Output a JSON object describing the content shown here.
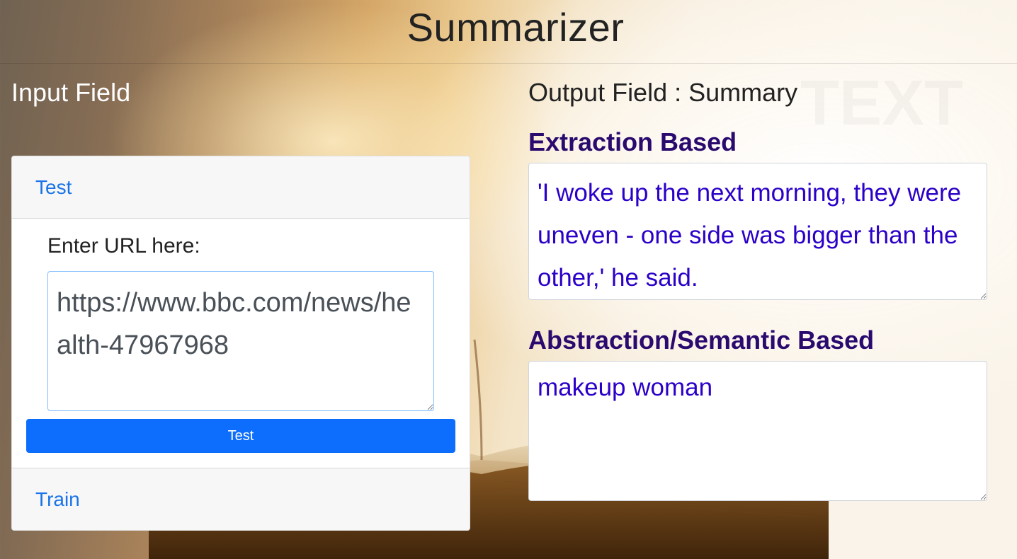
{
  "header": {
    "title": "Summarizer"
  },
  "input_panel": {
    "heading": "Input Field",
    "tabs": {
      "test_label": "Test",
      "train_label": "Train"
    },
    "url_label": "Enter URL here:",
    "url_value": "https://www.bbc.com/news/health-47967968",
    "submit_label": "Test"
  },
  "output_panel": {
    "heading": "Output Field : Summary",
    "extraction": {
      "title": "Extraction Based",
      "text": "'I woke up the next morning, they were uneven - one side was bigger than the other,' he said."
    },
    "abstraction": {
      "title": "Abstraction/Semantic Based",
      "text": "makeup woman"
    }
  },
  "colors": {
    "link": "#1a73e8",
    "button": "#0d6efd",
    "section_title": "#2a0a6e",
    "output_text": "#2b00c8"
  },
  "icons": {
    "resize_handle": "resize-grip-icon"
  }
}
